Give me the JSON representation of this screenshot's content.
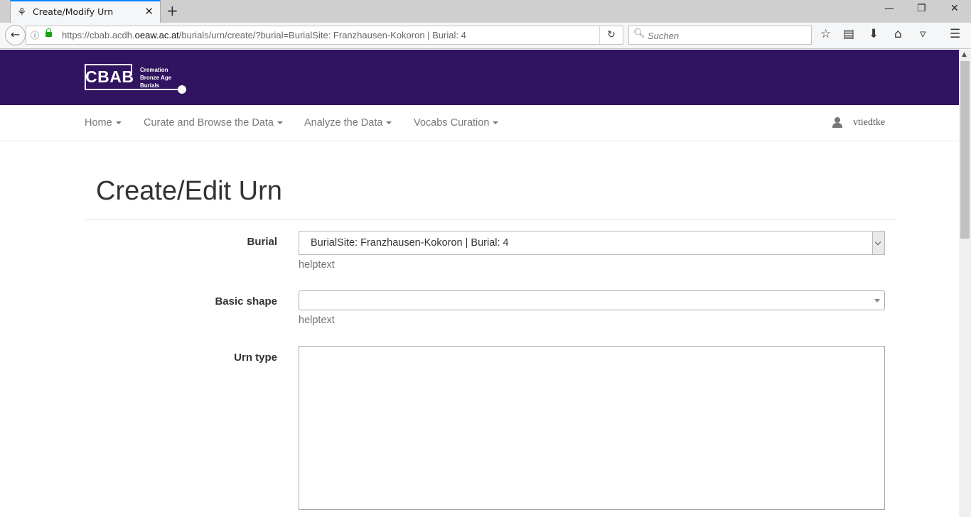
{
  "browser": {
    "tab_title": "Create/Modify Urn",
    "tab_favicon": "cbab-favicon",
    "url_prefix": "https://cbab.acdh.",
    "url_domain": "oeaw.ac.at",
    "url_path": "/burials/urn/create/?burial=BurialSite: Franzhausen-Kokoron | Burial: 4",
    "search_placeholder": "Suchen"
  },
  "site": {
    "logo_word": "CBAB",
    "logo_sub": [
      "Cremation",
      "Bronze Age",
      "Burials"
    ],
    "header_color": "#311460"
  },
  "menu": {
    "items": [
      {
        "label": "Home"
      },
      {
        "label": "Curate and Browse the Data"
      },
      {
        "label": "Analyze the Data"
      },
      {
        "label": "Vocabs Curation"
      }
    ],
    "username": "vtiedtke"
  },
  "page": {
    "title": "Create/Edit Urn"
  },
  "form": {
    "burial": {
      "label": "Burial",
      "value": "BurialSite: Franzhausen-Kokoron | Burial: 4",
      "help": "helptext"
    },
    "basic_shape": {
      "label": "Basic shape",
      "value": "",
      "help": "helptext"
    },
    "urn_type": {
      "label": "Urn type",
      "value": ""
    }
  }
}
